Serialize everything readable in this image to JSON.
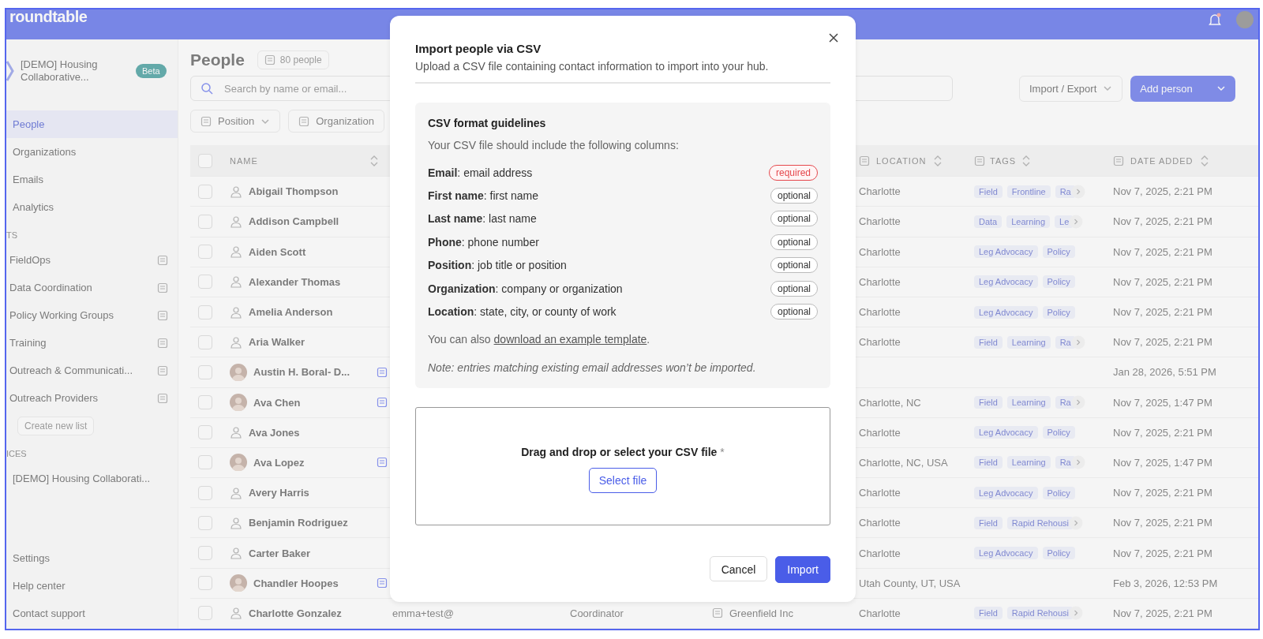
{
  "app": {
    "logo": "roundtable",
    "sidebar": {
      "workspace": {
        "name": "[DEMO] Housing Collaborative...",
        "badge": "Beta"
      },
      "nav": [
        {
          "label": "People",
          "selected": true
        },
        {
          "label": "Organizations",
          "selected": false
        },
        {
          "label": "Emails",
          "selected": false
        },
        {
          "label": "Analytics",
          "selected": false
        }
      ],
      "lists_heading": "TS",
      "lists": [
        {
          "label": "FieldOps"
        },
        {
          "label": "Data Coordination"
        },
        {
          "label": "Policy Working Groups"
        },
        {
          "label": "Training"
        },
        {
          "label": "Outreach & Communicati..."
        },
        {
          "label": "Outreach Providers"
        }
      ],
      "create_list": "Create new list",
      "spaces_heading": "ICES",
      "spaces": [
        {
          "label": "[DEMO] Housing Collaborati..."
        }
      ],
      "footer": [
        {
          "label": "Settings"
        },
        {
          "label": "Help center"
        },
        {
          "label": "Contact support"
        }
      ]
    },
    "page": {
      "title": "People",
      "count": "80 people",
      "search": {
        "placeholder": "Search by name or email..."
      },
      "import_export": "Import / Export",
      "add_person": "Add person",
      "filters": [
        {
          "label": "Position"
        },
        {
          "label": "Organization"
        }
      ],
      "table": {
        "select_all": {
          "checked": false
        },
        "columns": [
          {
            "label": "NAME"
          },
          {
            "label": "LOCATION"
          },
          {
            "label": "TAGS"
          },
          {
            "label": "DATE ADDED"
          }
        ],
        "rows": [
          {
            "checked": false,
            "photo": false,
            "name": "Abigail Thompson",
            "location": "Charlotte",
            "tags": [
              "Field",
              "Frontline",
              "Ra"
            ],
            "more_tags": true,
            "date": "Nov 7, 2025, 2:21 PM"
          },
          {
            "checked": false,
            "photo": false,
            "name": "Addison Campbell",
            "location": "Charlotte",
            "tags": [
              "Data",
              "Learning",
              "Le"
            ],
            "more_tags": true,
            "date": "Nov 7, 2025, 2:21 PM"
          },
          {
            "checked": false,
            "photo": false,
            "name": "Aiden Scott",
            "location": "Charlotte",
            "tags": [
              "Leg Advocacy",
              "Policy"
            ],
            "more_tags": false,
            "date": "Nov 7, 2025, 2:21 PM"
          },
          {
            "checked": false,
            "photo": false,
            "name": "Alexander Thomas",
            "location": "Charlotte",
            "tags": [
              "Leg Advocacy",
              "Policy"
            ],
            "more_tags": false,
            "date": "Nov 7, 2025, 2:21 PM"
          },
          {
            "checked": false,
            "photo": false,
            "name": "Amelia Anderson",
            "location": "Charlotte",
            "tags": [
              "Leg Advocacy",
              "Policy"
            ],
            "more_tags": false,
            "date": "Nov 7, 2025, 2:21 PM"
          },
          {
            "checked": false,
            "photo": false,
            "name": "Aria Walker",
            "location": "Charlotte",
            "tags": [
              "Field",
              "Learning",
              "Ra"
            ],
            "more_tags": true,
            "date": "Nov 7, 2025, 2:21 PM"
          },
          {
            "checked": false,
            "photo": true,
            "name": "Austin H. Boral- D...",
            "list_icon": true,
            "date": "Jan 28, 2026, 5:51 PM"
          },
          {
            "checked": false,
            "photo": true,
            "name": "Ava Chen",
            "list_icon": true,
            "location": "Charlotte, NC",
            "tags": [
              "Field",
              "Learning",
              "Ra"
            ],
            "more_tags": true,
            "date": "Nov 7, 2025, 1:47 PM"
          },
          {
            "checked": false,
            "photo": false,
            "name": "Ava Jones",
            "location": "Charlotte",
            "tags": [
              "Leg Advocacy",
              "Policy"
            ],
            "more_tags": false,
            "date": "Nov 7, 2025, 2:21 PM"
          },
          {
            "checked": false,
            "photo": true,
            "name": "Ava Lopez",
            "list_icon": true,
            "location": "Charlotte, NC, USA",
            "tags": [
              "Field",
              "Learning",
              "Ra"
            ],
            "more_tags": true,
            "date": "Nov 7, 2025, 1:47 PM"
          },
          {
            "checked": false,
            "photo": false,
            "name": "Avery Harris",
            "location": "Charlotte",
            "tags": [
              "Leg Advocacy",
              "Policy"
            ],
            "more_tags": false,
            "date": "Nov 7, 2025, 2:21 PM"
          },
          {
            "checked": false,
            "photo": false,
            "name": "Benjamin Rodriguez",
            "location": "Charlotte",
            "tags": [
              "Field",
              "Rapid Rehousi"
            ],
            "more_tags": true,
            "date": "Nov 7, 2025, 2:21 PM"
          },
          {
            "checked": false,
            "photo": false,
            "name": "Carter Baker",
            "location": "Charlotte",
            "tags": [
              "Leg Advocacy",
              "Policy"
            ],
            "more_tags": false,
            "date": "Nov 7, 2025, 2:21 PM"
          },
          {
            "checked": false,
            "photo": true,
            "name": "Chandler Hoopes",
            "list_icon": true,
            "location": "Utah County, UT, USA",
            "date": "Feb 3, 2026, 12:53 PM"
          },
          {
            "checked": false,
            "photo": false,
            "name": "Charlotte Gonzalez",
            "email": "emma+test@",
            "position": "Coordinator",
            "organization": "Greenfield Inc",
            "location": "Charlotte",
            "tags": [
              "Field",
              "Rapid Rehousi"
            ],
            "more_tags": true,
            "date": "Nov 7, 2025, 2:21 PM"
          }
        ]
      }
    }
  },
  "dialog": {
    "title": "Import people via CSV",
    "subtitle": "Upload a CSV file containing contact information to import into your hub.",
    "guidelines": {
      "heading": "CSV format guidelines",
      "intro": "Your CSV file should include the following columns:",
      "fields": [
        {
          "text": "**Email**: email address",
          "badge": "required",
          "required": true
        },
        {
          "text": "**First name**: first name",
          "badge": "optional",
          "required": false
        },
        {
          "text": "**Last name**: last name",
          "badge": "optional",
          "required": false
        },
        {
          "text": "**Phone**: phone number",
          "badge": "optional",
          "required": false
        },
        {
          "text": "**Position**: job title or position",
          "badge": "optional",
          "required": false
        },
        {
          "text": "**Organization**: company or organization",
          "badge": "optional",
          "required": false
        },
        {
          "text": "**Location**: state, city, or county of work",
          "badge": "optional",
          "required": false
        }
      ],
      "template_before": "You can also ",
      "template_link": "download an example template",
      "template_after": ".",
      "note": "Note: entries matching existing email addresses won’t be imported."
    },
    "dropzone": {
      "label": "Drag and drop or select your CSV file",
      "required_mark": "*",
      "button": "Select file"
    },
    "buttons": [
      {
        "label": "Cancel",
        "kind": "secondary"
      },
      {
        "label": "Import",
        "kind": "primary"
      }
    ]
  }
}
